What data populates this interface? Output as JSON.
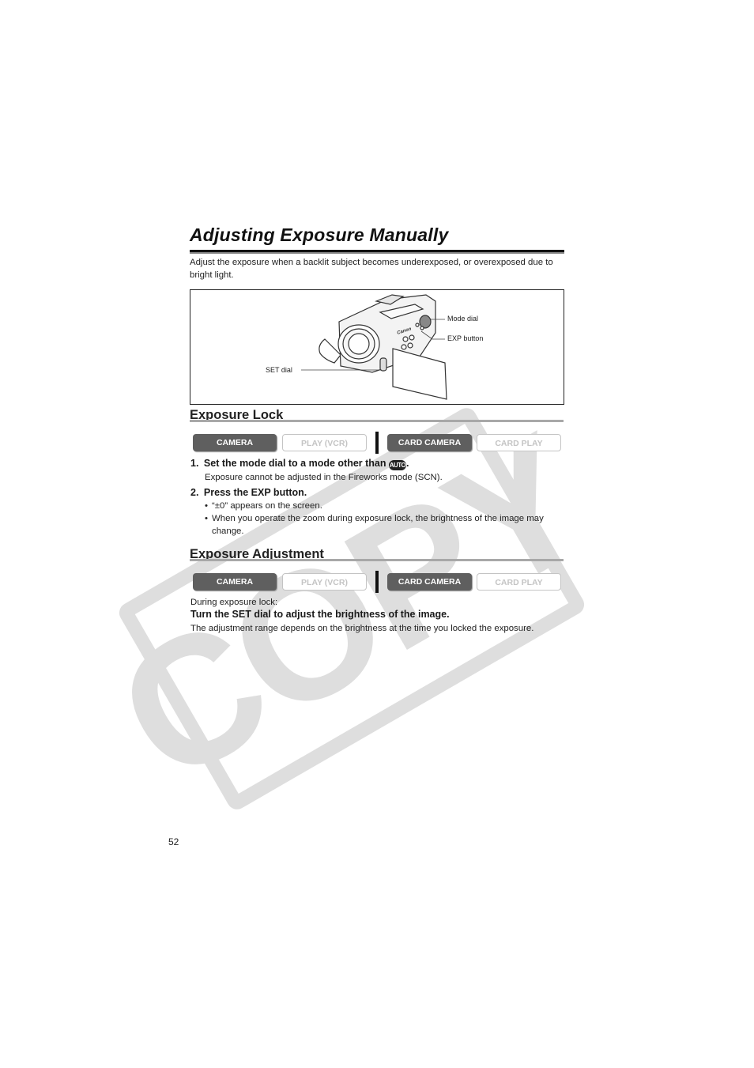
{
  "page": {
    "title": "Adjusting Exposure Manually",
    "intro": "Adjust the exposure when a backlit subject becomes underexposed, or overexposed due to bright light.",
    "page_number": "52",
    "watermark": "COPY"
  },
  "figure": {
    "callouts": {
      "mode_dial": "Mode dial",
      "exp_button": "EXP button",
      "set_dial": "SET dial"
    }
  },
  "sections": [
    {
      "heading": "Exposure Lock",
      "modes": [
        {
          "label": "CAMERA",
          "active": true
        },
        {
          "label": "PLAY (VCR)",
          "active": false
        },
        {
          "label": "CARD CAMERA",
          "active": true
        },
        {
          "label": "CARD PLAY",
          "active": false
        }
      ],
      "steps": [
        {
          "number": "1.",
          "text": "Set the mode dial to a mode other than",
          "icon_label": "AUTO",
          "suffix": ".",
          "note": "Exposure cannot be adjusted in the Fireworks mode (SCN)."
        },
        {
          "number": "2.",
          "text": "Press the EXP button.",
          "bullets": [
            "“±0” appears on the screen.",
            "When you operate the zoom during exposure lock, the brightness of the image may change."
          ]
        }
      ]
    },
    {
      "heading": "Exposure Adjustment",
      "modes": [
        {
          "label": "CAMERA",
          "active": true
        },
        {
          "label": "PLAY (VCR)",
          "active": false
        },
        {
          "label": "CARD CAMERA",
          "active": true
        },
        {
          "label": "CARD PLAY",
          "active": false
        }
      ],
      "pre": "During exposure lock:",
      "instruction": "Turn the SET dial to adjust the brightness of the image.",
      "note": "The adjustment range depends on the brightness at the time you locked the exposure."
    }
  ],
  "colors": {
    "badge_active": "#5f5f5f",
    "badge_inactive": "#c4c4c4",
    "watermark": "#d9d9d9"
  }
}
